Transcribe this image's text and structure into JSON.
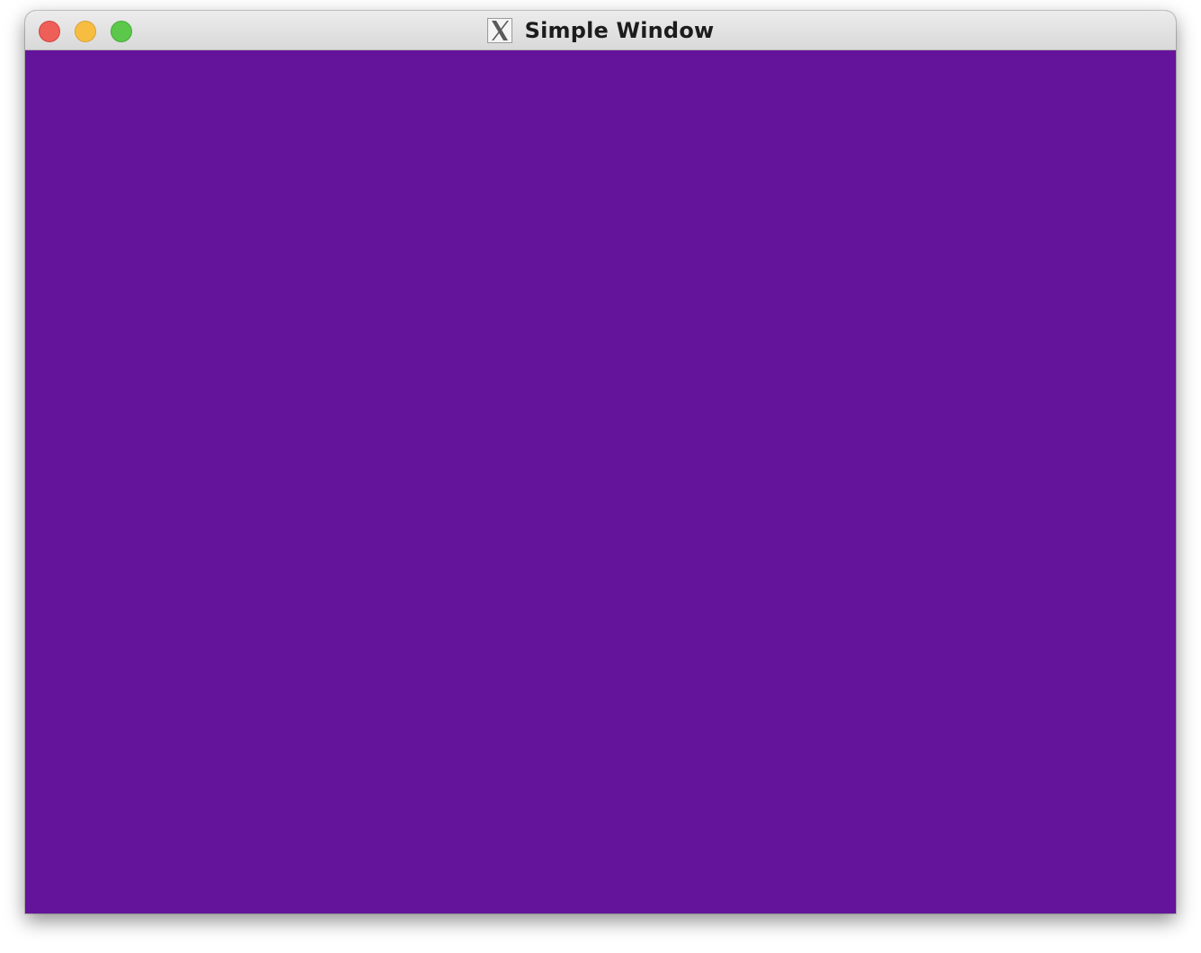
{
  "window": {
    "title": "Simple Window",
    "app_icon": "x11-icon",
    "content_color": "#64149a"
  },
  "titlebar": {
    "buttons": [
      {
        "name": "close",
        "color": "#ed5f57"
      },
      {
        "name": "minimize",
        "color": "#f6bd41"
      },
      {
        "name": "zoom",
        "color": "#5cc84b"
      }
    ]
  }
}
